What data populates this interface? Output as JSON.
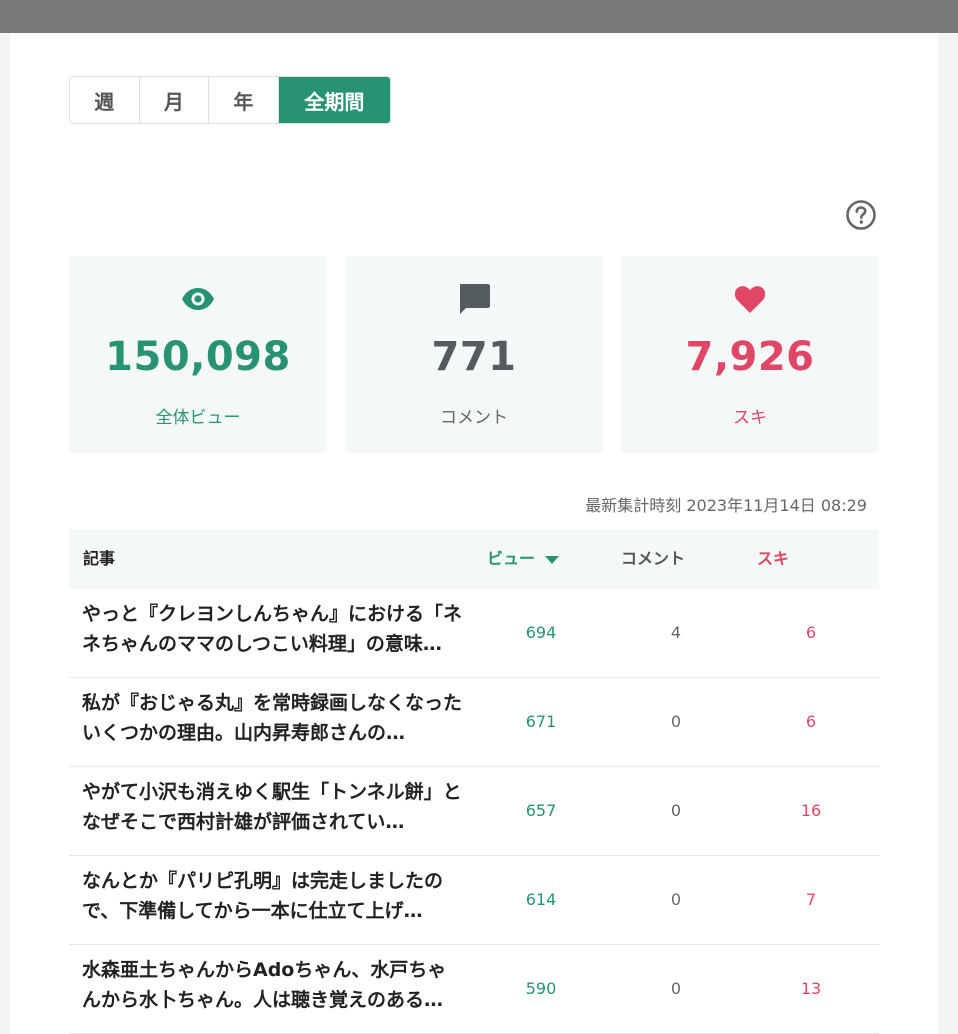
{
  "period_tabs": [
    {
      "label": "週",
      "active": false
    },
    {
      "label": "月",
      "active": false
    },
    {
      "label": "年",
      "active": false
    },
    {
      "label": "全期間",
      "active": true
    }
  ],
  "stats": {
    "views": {
      "value": "150,098",
      "label": "全体ビュー",
      "icon": "eye-icon"
    },
    "comments": {
      "value": "771",
      "label": "コメント",
      "icon": "comment-icon"
    },
    "likes": {
      "value": "7,926",
      "label": "スキ",
      "icon": "heart-icon"
    }
  },
  "updated_at": "最新集計時刻 2023年11月14日 08:29",
  "table": {
    "headers": {
      "article": "記事",
      "views": "ビュー",
      "comments": "コメント",
      "likes": "スキ"
    },
    "rows": [
      {
        "title": "やっと『クレヨンしんちゃん』における「ネネちゃんのママのしつこい料理」の意味…",
        "views": "694",
        "comments": "4",
        "likes": "6"
      },
      {
        "title": "私が『おじゃる丸』を常時録画しなくなったいくつかの理由。山内昇寿郎さんの…",
        "views": "671",
        "comments": "0",
        "likes": "6"
      },
      {
        "title": "やがて小沢も消えゆく駅生「トンネル餅」となぜそこで西村計雄が評価されてい…",
        "views": "657",
        "comments": "0",
        "likes": "16"
      },
      {
        "title": "なんとか『パリピ孔明』は完走しましたので、下準備してから一本に仕立て上げ…",
        "views": "614",
        "comments": "0",
        "likes": "7"
      },
      {
        "title": "水森亜土ちゃんからAdoちゃん、水戸ちゃんから水卜ちゃん。人は聴き覚えのある…",
        "views": "590",
        "comments": "0",
        "likes": "13"
      }
    ]
  },
  "colors": {
    "accent": "#279373",
    "like": "#e04766",
    "neutral": "#555c60"
  }
}
